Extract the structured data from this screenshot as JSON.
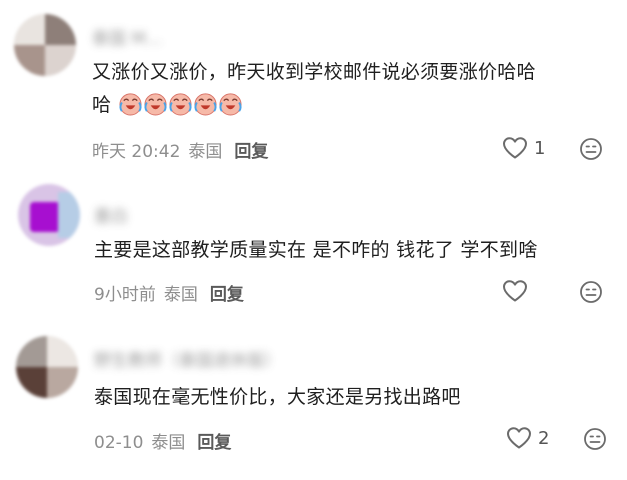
{
  "comments": [
    {
      "username": "泰国 M...",
      "text_line1": "又涨价又涨价，昨天收到学校邮件说必须要涨价哈哈",
      "text_line2": "哈",
      "sticker_icon": "crying-laughing-face-sticker",
      "time": "昨天 20:42",
      "location": "泰国",
      "reply_label": "回复",
      "likes": "1"
    },
    {
      "username": "墨白",
      "text_line1": "主要是这部教学质量实在 是不咋的 钱花了 学不到啥",
      "time": "9小时前",
      "location": "泰国",
      "reply_label": "回复",
      "likes": ""
    },
    {
      "username": "野生教师（泰国退休版）",
      "text_line1": "泰国现在毫无性价比，大家还是另找出路吧",
      "time": "02-10",
      "location": "泰国",
      "reply_label": "回复",
      "likes": "2"
    }
  ],
  "icons": {
    "like": "heart-outline-icon",
    "emoji": "emoji-face-icon"
  },
  "colors": {
    "icon_stroke": "#6b6b6b",
    "meta_text": "#8e8e8e",
    "body_text": "#1f1f1f"
  }
}
